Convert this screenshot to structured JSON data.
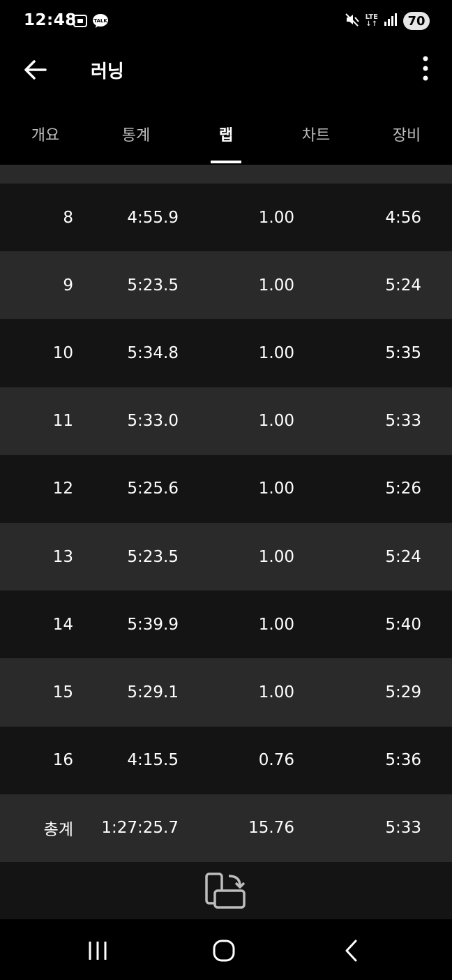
{
  "status": {
    "time": "12:48",
    "battery": "70",
    "network": "LTE"
  },
  "app_bar": {
    "title": "러닝"
  },
  "tabs": [
    {
      "label": "개요"
    },
    {
      "label": "통계"
    },
    {
      "label": "랩"
    },
    {
      "label": "차트"
    },
    {
      "label": "장비"
    }
  ],
  "active_tab": "랩",
  "laps": [
    {
      "lap": "8",
      "time": "4:55.9",
      "distance": "1.00",
      "pace": "4:56"
    },
    {
      "lap": "9",
      "time": "5:23.5",
      "distance": "1.00",
      "pace": "5:24"
    },
    {
      "lap": "10",
      "time": "5:34.8",
      "distance": "1.00",
      "pace": "5:35"
    },
    {
      "lap": "11",
      "time": "5:33.0",
      "distance": "1.00",
      "pace": "5:33"
    },
    {
      "lap": "12",
      "time": "5:25.6",
      "distance": "1.00",
      "pace": "5:26"
    },
    {
      "lap": "13",
      "time": "5:23.5",
      "distance": "1.00",
      "pace": "5:24"
    },
    {
      "lap": "14",
      "time": "5:39.9",
      "distance": "1.00",
      "pace": "5:40"
    },
    {
      "lap": "15",
      "time": "5:29.1",
      "distance": "1.00",
      "pace": "5:29"
    },
    {
      "lap": "16",
      "time": "4:15.5",
      "distance": "0.76",
      "pace": "5:36"
    }
  ],
  "total": {
    "label": "총계",
    "time": "1:27:25.7",
    "distance": "15.76",
    "pace": "5:33"
  },
  "colors": {
    "background": "#000000",
    "row_dark": "#141414",
    "row_light": "#2a2a2a",
    "tab_inactive": "#bdbdbd"
  }
}
